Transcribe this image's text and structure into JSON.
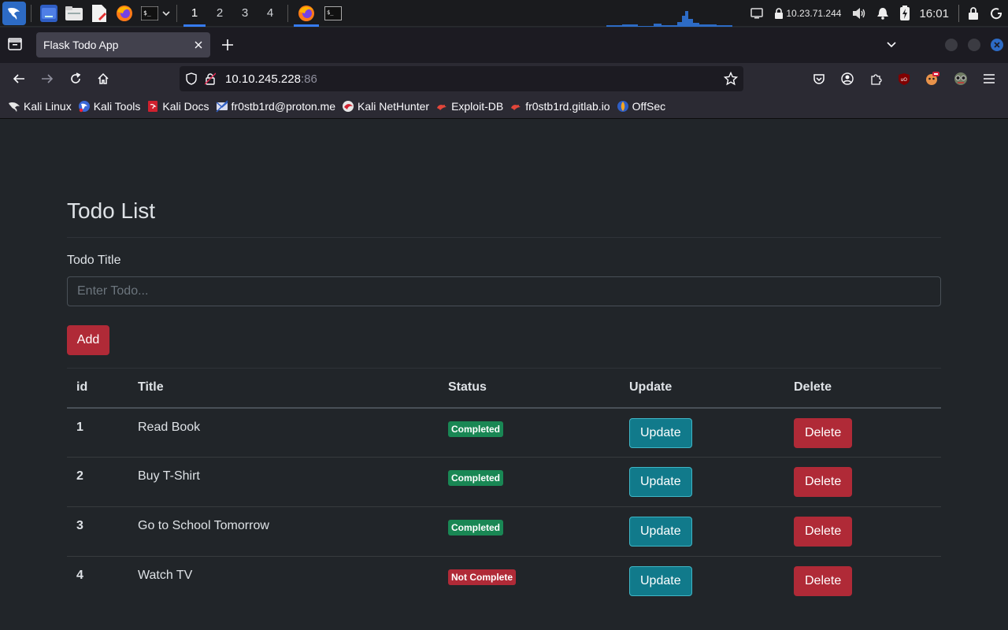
{
  "panel": {
    "workspaces": [
      "1",
      "2",
      "3",
      "4"
    ],
    "active_workspace": "1",
    "vpn_ip": "10.23.71.244",
    "clock": "16:01"
  },
  "browser": {
    "tab_title": "Flask Todo App",
    "url_host": "10.10.245.228",
    "url_port": ":86",
    "bookmarks": [
      {
        "label": "Kali Linux",
        "icon": "kali-dragon-icon"
      },
      {
        "label": "Kali Tools",
        "icon": "kali-tools-icon"
      },
      {
        "label": "Kali Docs",
        "icon": "kali-docs-icon"
      },
      {
        "label": "fr0stb1rd@proton.me",
        "icon": "proton-icon"
      },
      {
        "label": "Kali NetHunter",
        "icon": "nethunter-icon"
      },
      {
        "label": "Exploit-DB",
        "icon": "exploit-db-icon"
      },
      {
        "label": "fr0stb1rd.gitlab.io",
        "icon": "exploit-db-icon"
      },
      {
        "label": "OffSec",
        "icon": "offsec-icon"
      }
    ]
  },
  "page": {
    "heading": "Todo List",
    "field_label": "Todo Title",
    "input_placeholder": "Enter Todo...",
    "add_label": "Add",
    "table": {
      "headers": [
        "id",
        "Title",
        "Status",
        "Update",
        "Delete"
      ],
      "rows": [
        {
          "id": "1",
          "title": "Read Book",
          "status": "Completed",
          "done": true,
          "update_label": "Update",
          "delete_label": "Delete"
        },
        {
          "id": "2",
          "title": "Buy T-Shirt",
          "status": "Completed",
          "done": true,
          "update_label": "Update",
          "delete_label": "Delete"
        },
        {
          "id": "3",
          "title": "Go to School Tomorrow",
          "status": "Completed",
          "done": true,
          "update_label": "Update",
          "delete_label": "Delete"
        },
        {
          "id": "4",
          "title": "Watch TV",
          "status": "Not Complete",
          "done": false,
          "update_label": "Update",
          "delete_label": "Delete"
        }
      ]
    }
  },
  "colors": {
    "page_bg": "#212529",
    "danger": "#b02a37",
    "info": "#117a8b",
    "success": "#198754",
    "accent": "#367bf0"
  }
}
